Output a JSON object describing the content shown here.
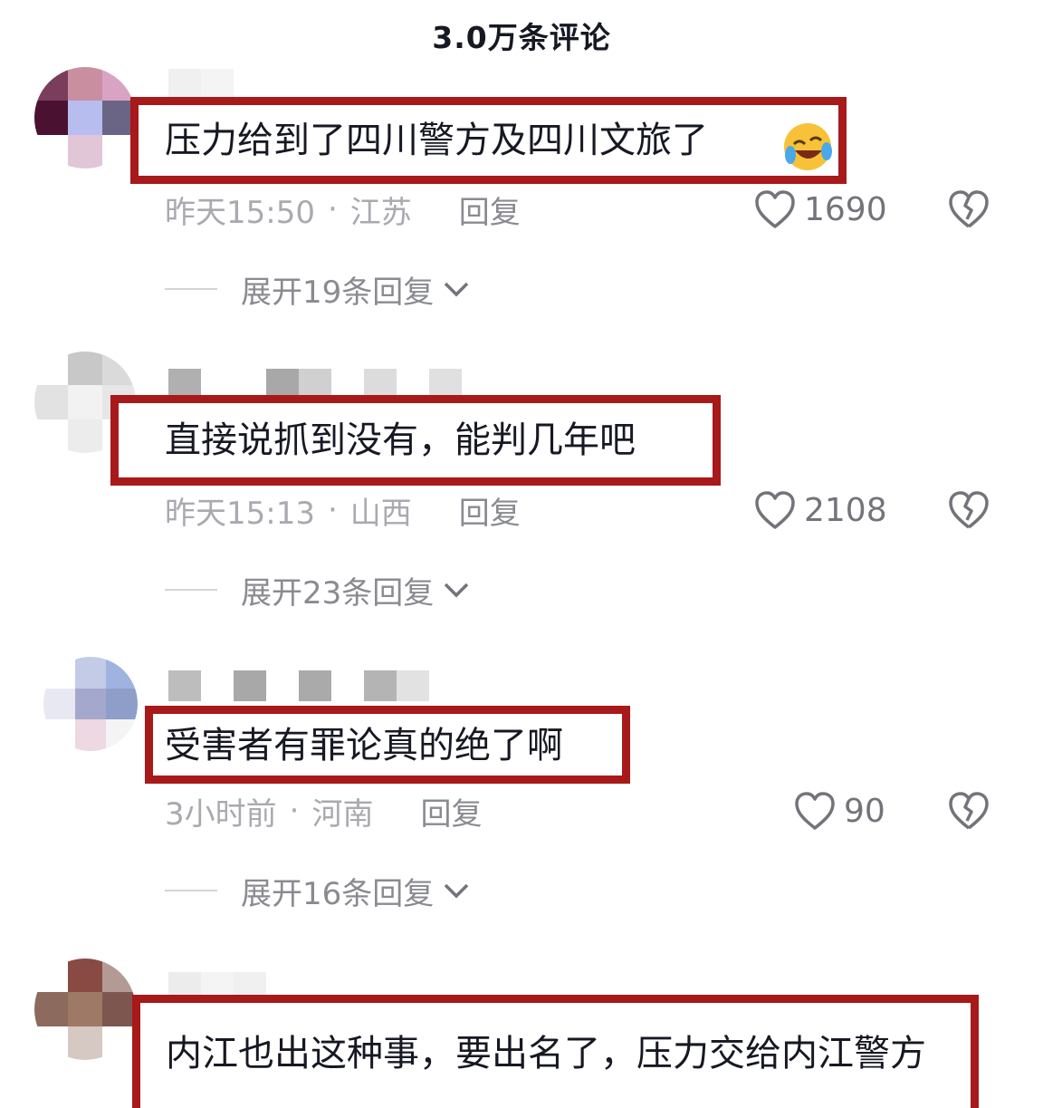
{
  "header": {
    "title": "3.0万条评论"
  },
  "comments": [
    {
      "text": "压力给到了四川警方及四川文旅了",
      "emoji": "laughing-crying-emoji",
      "time": "昨天15:50",
      "location": "江苏",
      "reply_label": "回复",
      "likes": "1690",
      "expand_label": "展开19条回复"
    },
    {
      "text": "直接说抓到没有，能判几年吧",
      "time": "昨天15:13",
      "location": "山西",
      "reply_label": "回复",
      "likes": "2108",
      "expand_label": "展开23条回复"
    },
    {
      "text": "受害者有罪论真的绝了啊",
      "time": "3小时前",
      "location": "河南",
      "reply_label": "回复",
      "likes": "90",
      "expand_label": "展开16条回复"
    },
    {
      "text": "内江也出这种事，要出名了，压力交给内江警方"
    }
  ],
  "separator": "·",
  "colors": {
    "highlight_border": "#a8191a",
    "text_primary": "#161823",
    "text_secondary": "#a9aab0"
  },
  "icons": [
    "heart-outline-icon",
    "broken-heart-icon",
    "chevron-down-icon"
  ]
}
